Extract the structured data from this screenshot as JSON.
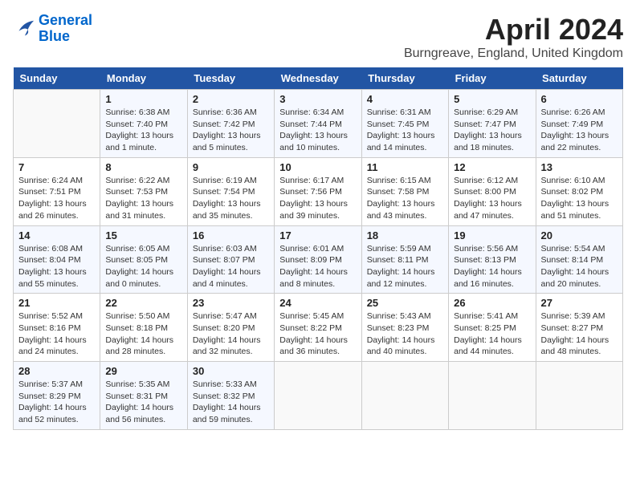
{
  "header": {
    "logo_line1": "General",
    "logo_line2": "Blue",
    "month": "April 2024",
    "location": "Burngreave, England, United Kingdom"
  },
  "days_of_week": [
    "Sunday",
    "Monday",
    "Tuesday",
    "Wednesday",
    "Thursday",
    "Friday",
    "Saturday"
  ],
  "weeks": [
    [
      {
        "day": "",
        "info": ""
      },
      {
        "day": "1",
        "info": "Sunrise: 6:38 AM\nSunset: 7:40 PM\nDaylight: 13 hours\nand 1 minute."
      },
      {
        "day": "2",
        "info": "Sunrise: 6:36 AM\nSunset: 7:42 PM\nDaylight: 13 hours\nand 5 minutes."
      },
      {
        "day": "3",
        "info": "Sunrise: 6:34 AM\nSunset: 7:44 PM\nDaylight: 13 hours\nand 10 minutes."
      },
      {
        "day": "4",
        "info": "Sunrise: 6:31 AM\nSunset: 7:45 PM\nDaylight: 13 hours\nand 14 minutes."
      },
      {
        "day": "5",
        "info": "Sunrise: 6:29 AM\nSunset: 7:47 PM\nDaylight: 13 hours\nand 18 minutes."
      },
      {
        "day": "6",
        "info": "Sunrise: 6:26 AM\nSunset: 7:49 PM\nDaylight: 13 hours\nand 22 minutes."
      }
    ],
    [
      {
        "day": "7",
        "info": "Sunrise: 6:24 AM\nSunset: 7:51 PM\nDaylight: 13 hours\nand 26 minutes."
      },
      {
        "day": "8",
        "info": "Sunrise: 6:22 AM\nSunset: 7:53 PM\nDaylight: 13 hours\nand 31 minutes."
      },
      {
        "day": "9",
        "info": "Sunrise: 6:19 AM\nSunset: 7:54 PM\nDaylight: 13 hours\nand 35 minutes."
      },
      {
        "day": "10",
        "info": "Sunrise: 6:17 AM\nSunset: 7:56 PM\nDaylight: 13 hours\nand 39 minutes."
      },
      {
        "day": "11",
        "info": "Sunrise: 6:15 AM\nSunset: 7:58 PM\nDaylight: 13 hours\nand 43 minutes."
      },
      {
        "day": "12",
        "info": "Sunrise: 6:12 AM\nSunset: 8:00 PM\nDaylight: 13 hours\nand 47 minutes."
      },
      {
        "day": "13",
        "info": "Sunrise: 6:10 AM\nSunset: 8:02 PM\nDaylight: 13 hours\nand 51 minutes."
      }
    ],
    [
      {
        "day": "14",
        "info": "Sunrise: 6:08 AM\nSunset: 8:04 PM\nDaylight: 13 hours\nand 55 minutes."
      },
      {
        "day": "15",
        "info": "Sunrise: 6:05 AM\nSunset: 8:05 PM\nDaylight: 14 hours\nand 0 minutes."
      },
      {
        "day": "16",
        "info": "Sunrise: 6:03 AM\nSunset: 8:07 PM\nDaylight: 14 hours\nand 4 minutes."
      },
      {
        "day": "17",
        "info": "Sunrise: 6:01 AM\nSunset: 8:09 PM\nDaylight: 14 hours\nand 8 minutes."
      },
      {
        "day": "18",
        "info": "Sunrise: 5:59 AM\nSunset: 8:11 PM\nDaylight: 14 hours\nand 12 minutes."
      },
      {
        "day": "19",
        "info": "Sunrise: 5:56 AM\nSunset: 8:13 PM\nDaylight: 14 hours\nand 16 minutes."
      },
      {
        "day": "20",
        "info": "Sunrise: 5:54 AM\nSunset: 8:14 PM\nDaylight: 14 hours\nand 20 minutes."
      }
    ],
    [
      {
        "day": "21",
        "info": "Sunrise: 5:52 AM\nSunset: 8:16 PM\nDaylight: 14 hours\nand 24 minutes."
      },
      {
        "day": "22",
        "info": "Sunrise: 5:50 AM\nSunset: 8:18 PM\nDaylight: 14 hours\nand 28 minutes."
      },
      {
        "day": "23",
        "info": "Sunrise: 5:47 AM\nSunset: 8:20 PM\nDaylight: 14 hours\nand 32 minutes."
      },
      {
        "day": "24",
        "info": "Sunrise: 5:45 AM\nSunset: 8:22 PM\nDaylight: 14 hours\nand 36 minutes."
      },
      {
        "day": "25",
        "info": "Sunrise: 5:43 AM\nSunset: 8:23 PM\nDaylight: 14 hours\nand 40 minutes."
      },
      {
        "day": "26",
        "info": "Sunrise: 5:41 AM\nSunset: 8:25 PM\nDaylight: 14 hours\nand 44 minutes."
      },
      {
        "day": "27",
        "info": "Sunrise: 5:39 AM\nSunset: 8:27 PM\nDaylight: 14 hours\nand 48 minutes."
      }
    ],
    [
      {
        "day": "28",
        "info": "Sunrise: 5:37 AM\nSunset: 8:29 PM\nDaylight: 14 hours\nand 52 minutes."
      },
      {
        "day": "29",
        "info": "Sunrise: 5:35 AM\nSunset: 8:31 PM\nDaylight: 14 hours\nand 56 minutes."
      },
      {
        "day": "30",
        "info": "Sunrise: 5:33 AM\nSunset: 8:32 PM\nDaylight: 14 hours\nand 59 minutes."
      },
      {
        "day": "",
        "info": ""
      },
      {
        "day": "",
        "info": ""
      },
      {
        "day": "",
        "info": ""
      },
      {
        "day": "",
        "info": ""
      }
    ]
  ]
}
